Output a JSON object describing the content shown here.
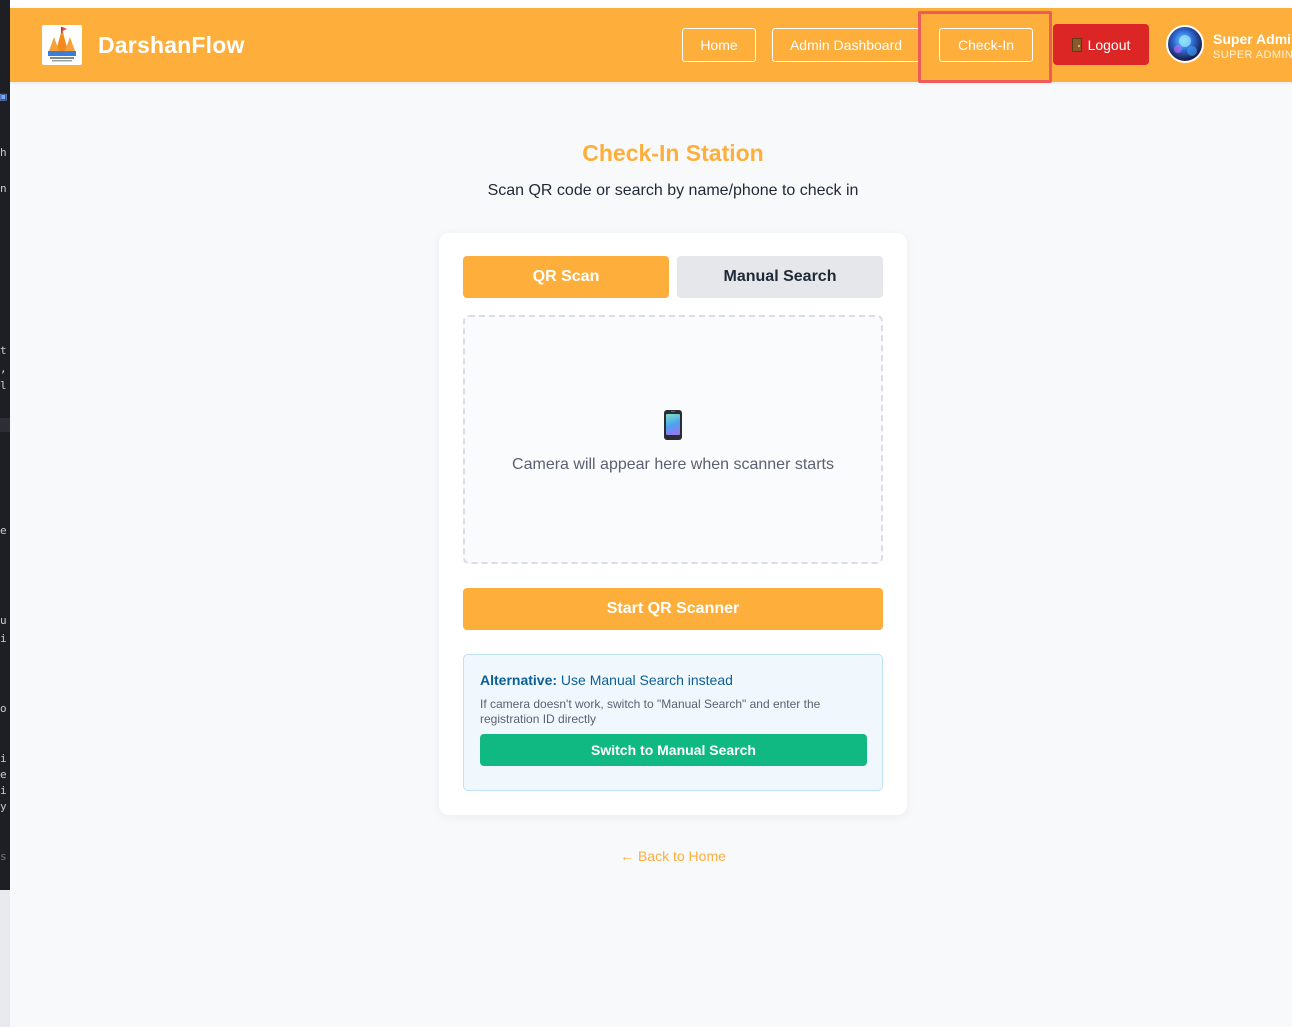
{
  "app": {
    "brand": "DarshanFlow",
    "accent_color": "#fdae3b",
    "danger_color": "#dc2626",
    "success_color": "#10b981"
  },
  "header": {
    "nav": {
      "home": "Home",
      "admin_dashboard": "Admin Dashboard",
      "check_in": "Check-In"
    },
    "logout_label": "Logout",
    "user": {
      "name": "Super Admin",
      "role": "SUPER ADMIN"
    }
  },
  "main": {
    "title": "Check-In Station",
    "subtitle": "Scan QR code or search by name/phone to check in",
    "tabs": [
      {
        "label": "QR Scan",
        "active": true
      },
      {
        "label": "Manual Search",
        "active": false
      }
    ],
    "camera_placeholder": "Camera will appear here when scanner starts",
    "camera_icon": "mobile-phone-icon",
    "start_scanner_label": "Start QR Scanner",
    "alternative": {
      "heading": "Alternative:",
      "heading_rest": "Use Manual Search instead",
      "description": "If camera doesn't work, switch to \"Manual Search\" and enter the registration ID directly",
      "switch_label": "Switch to Manual Search"
    },
    "back_link": "← Back to Home"
  }
}
